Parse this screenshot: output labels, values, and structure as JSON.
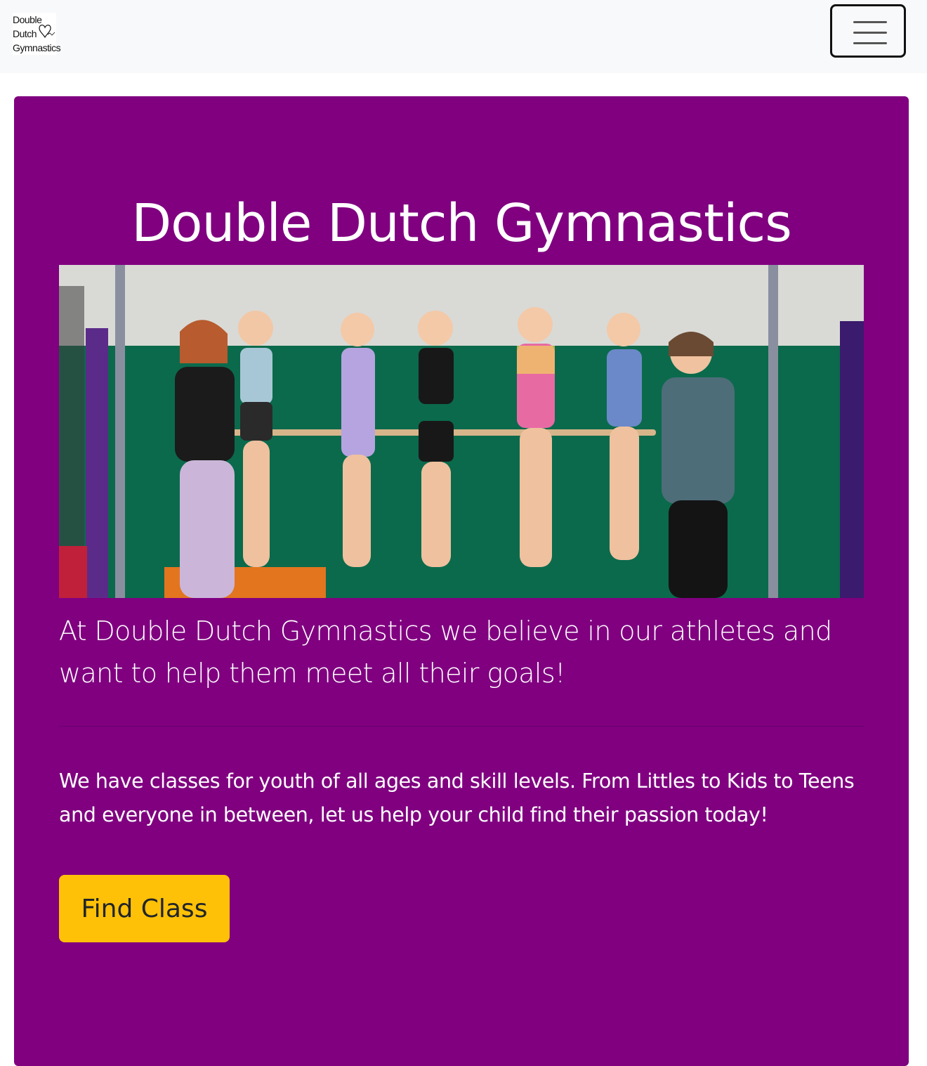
{
  "navbar": {
    "logo_lines": [
      "Double",
      "Dutch",
      "Gymnastics"
    ],
    "toggler_icon": "hamburger-menu-icon"
  },
  "hero": {
    "title": "Double Dutch Gymnastics",
    "image_icon": "group-photo",
    "lead": "At Double Dutch Gymnastics we believe in our athletes and want to help them meet all their goals!",
    "body": "We have classes for youth of all ages and skill levels. From Littles to Kids to Teens and everyone in between, let us help your child find their passion today!",
    "cta_label": "Find Class"
  },
  "colors": {
    "hero_bg": "#800080",
    "navbar_bg": "#f8f9fa",
    "cta_bg": "#ffc107",
    "text_light": "#ffffff",
    "cta_text": "#212529"
  }
}
